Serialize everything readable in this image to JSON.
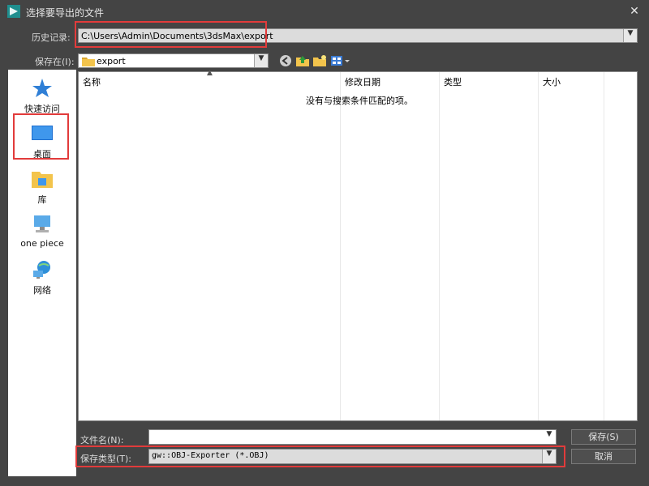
{
  "window": {
    "title": "选择要导出的文件",
    "close_label": "✕"
  },
  "history": {
    "label": "历史记录:",
    "value": "C:\\Users\\Admin\\Documents\\3dsMax\\export"
  },
  "save_in": {
    "label": "保存在(I):",
    "value": "export"
  },
  "places": [
    {
      "label": "快速访问",
      "icon": "star-icon"
    },
    {
      "label": "桌面",
      "icon": "desktop-icon"
    },
    {
      "label": "库",
      "icon": "library-folder-icon"
    },
    {
      "label": "one piece",
      "icon": "computer-icon"
    },
    {
      "label": "网络",
      "icon": "network-icon"
    }
  ],
  "file_list": {
    "columns": [
      "名称",
      "修改日期",
      "类型",
      "大小"
    ],
    "empty_message": "没有与搜索条件匹配的项。"
  },
  "filename": {
    "label": "文件名(N):",
    "value": ""
  },
  "filetype": {
    "label": "保存类型(T):",
    "value": "gw::OBJ-Exporter (*.OBJ)"
  },
  "buttons": {
    "save": "保存(S)",
    "cancel": "取消"
  },
  "colors": {
    "window_bg": "#444444",
    "highlight_box": "#e23b3b",
    "list_bg": "#ffffff"
  }
}
